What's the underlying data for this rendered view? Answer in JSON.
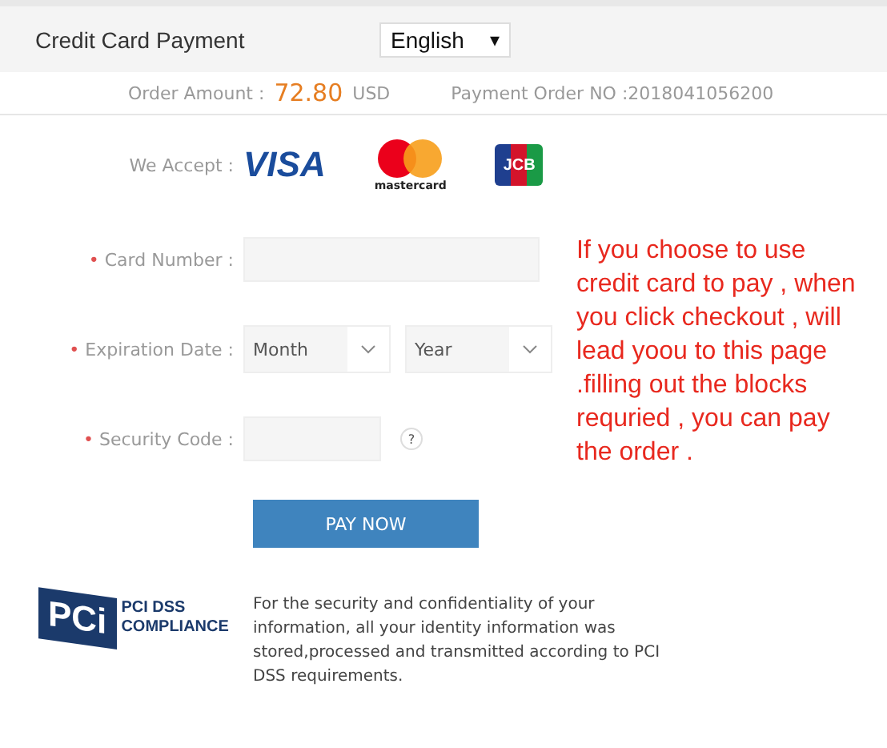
{
  "header": {
    "title": "Credit Card Payment",
    "language": "English",
    "caret": "▾"
  },
  "order": {
    "amount_label": "Order Amount :",
    "amount": "72.80",
    "currency": "USD",
    "order_no": "Payment Order NO :2018041056200"
  },
  "accept": {
    "label": "We Accept :",
    "cards": [
      {
        "kind": "visa",
        "text": "VISA"
      },
      {
        "kind": "mastercard",
        "text": "mastercard"
      },
      {
        "kind": "jcb",
        "text": "JCB"
      }
    ]
  },
  "fields": [
    {
      "kind": "text",
      "label": "Card Number :",
      "required": true
    },
    {
      "kind": "expiry",
      "label": "Expiration Date :",
      "required": true,
      "selects": [
        "Month",
        "Year"
      ]
    },
    {
      "kind": "cvv",
      "label": "Security Code :",
      "required": true,
      "help": "?"
    }
  ],
  "required_mark": "•",
  "button": "PAY NOW",
  "note": {
    "lines": [
      "If you choose to use",
      "credit card to pay , when",
      "you click checkout , will",
      "lead yoou to this page",
      ".filling out the blocks",
      "requried , you can pay",
      "the order ."
    ]
  },
  "pci": {
    "logo": "PCi",
    "title": "PCI DSS",
    "subtitle": "COMPLIANCE",
    "lines": [
      "For the security and confidentiality of your",
      "information, all your identity information was",
      "stored,processed and transmitted according to PCI",
      "DSS requirements."
    ]
  }
}
